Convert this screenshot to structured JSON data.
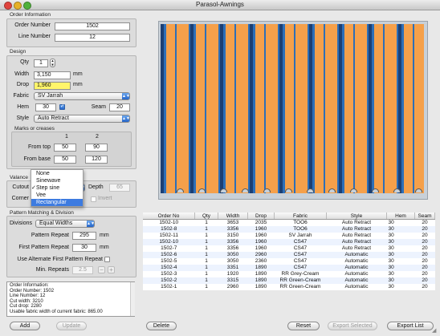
{
  "window": {
    "title": "Parasol-Awnings"
  },
  "order_info": {
    "section": "Order Information",
    "order_number_label": "Order Number",
    "order_number": "1502",
    "line_number_label": "Line Number",
    "line_number": "12"
  },
  "design": {
    "section": "Design",
    "qty_label": "Qty",
    "qty": "1",
    "width_label": "Width",
    "width": "3,150",
    "width_unit": "mm",
    "drop_label": "Drop",
    "drop": "1,960",
    "drop_unit": "mm",
    "fabric_label": "Fabric",
    "fabric": "SV Jarrah",
    "hem_label": "Hem",
    "hem": "30",
    "seam_label": "Seam",
    "seam": "20",
    "style_label": "Style",
    "style": "Auto Retract"
  },
  "marks": {
    "section": "Marks or creases",
    "col1": "1",
    "col2": "2",
    "from_top_label": "From top",
    "from_top_1": "50",
    "from_top_2": "90",
    "from_base_label": "From base",
    "from_base_1": "50",
    "from_base_2": "120"
  },
  "valance": {
    "section": "Valance",
    "cutout_label": "Cutout",
    "corner_label": "Corner",
    "depth_label": "Depth",
    "depth": "65",
    "invert_label": "Invert",
    "menu": [
      "None",
      "Sinewave",
      "Step sine",
      "Vee",
      "Rectangular"
    ],
    "menu_checked_index": 2,
    "menu_highlight_index": 4
  },
  "pattern": {
    "section": "Pattern Matching & Division",
    "divisions_label": "Divisions",
    "divisions": "Equal Widths",
    "pattern_repeat_label": "Pattern Repeat",
    "pattern_repeat": "295",
    "pattern_repeat_unit": "mm",
    "first_pattern_repeat_label": "First Pattern Repeat",
    "first_pattern_repeat": "30",
    "first_pattern_repeat_unit": "mm",
    "alt_first_label": "Use Alternate First Pattern Repeat",
    "min_repeats_label": "Min. Repeats",
    "min_repeats": "2.5"
  },
  "info_lines": [
    "Order Information:",
    "Order Number: 1502",
    "Line Number: 12",
    "Cut width:  3210",
    "Cut drop: 2280",
    "Usable fabric width of current fabric: 865.00"
  ],
  "buttons": {
    "add": "Add",
    "update": "Update",
    "delete": "Delete",
    "reset": "Reset",
    "export_selected": "Export Selected",
    "export_list": "Export List"
  },
  "table": {
    "columns": [
      "Order No",
      "Qty",
      "Width",
      "Drop",
      "Fabric",
      "Style",
      "Hem",
      "Seam"
    ],
    "rows": [
      [
        "1502-10",
        "1",
        "3653",
        "2035",
        "TOO6",
        "Auto Retract",
        "30",
        "20"
      ],
      [
        "1502-8",
        "1",
        "3356",
        "1960",
        "TOO6",
        "Auto Retract",
        "30",
        "20"
      ],
      [
        "1502-11",
        "1",
        "3150",
        "1960",
        "SV Jarrah",
        "Auto Retract",
        "30",
        "20"
      ],
      [
        "1502-10",
        "1",
        "3356",
        "1960",
        "CS47",
        "Auto Retract",
        "30",
        "20"
      ],
      [
        "1502-7",
        "1",
        "3356",
        "1960",
        "CS47",
        "Auto Retract",
        "30",
        "20"
      ],
      [
        "1502-6",
        "1",
        "3050",
        "2960",
        "CS47",
        "Automatic",
        "30",
        "20"
      ],
      [
        "1502-5",
        "1",
        "3050",
        "2360",
        "CS47",
        "Automatic",
        "30",
        "20"
      ],
      [
        "1502-4",
        "1",
        "3351",
        "1890",
        "CS47",
        "Automatic",
        "30",
        "20"
      ],
      [
        "1502-3",
        "1",
        "1920",
        "1890",
        "RR Grey-Cream",
        "Automatic",
        "30",
        "20"
      ],
      [
        "1502-2",
        "1",
        "3315",
        "1890",
        "RR Green-Cream",
        "Automatic",
        "30",
        "20"
      ],
      [
        "1502-1",
        "1",
        "2960",
        "1890",
        "RR Green-Cream",
        "Automatic",
        "30",
        "20"
      ]
    ]
  },
  "colors": {
    "awning_orange": "#f5a04a",
    "awning_blue": "#2d6fb8",
    "awning_navy": "#1c3f73",
    "selection_blue": "#3875d7"
  }
}
